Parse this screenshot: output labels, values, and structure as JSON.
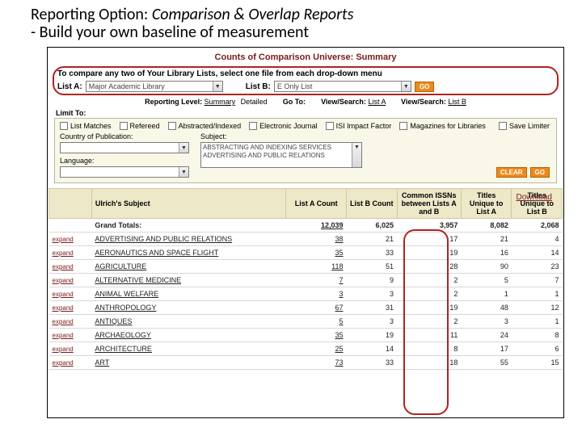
{
  "slide": {
    "title_prefix": "Reporting Option: ",
    "title_ital": "Comparison & Overlap Reports",
    "subtitle": " - Build your own baseline of measurement"
  },
  "report": {
    "title": "Counts of Comparison Universe: Summary",
    "compare_instruction": "To compare any two of Your Library Lists, select one file from each drop-down menu",
    "list_a_label": "List A:",
    "list_a_value": "Major Academic Library",
    "list_b_label": "List B:",
    "list_b_value": "E Only List",
    "go_label": "GO"
  },
  "reporting_line": {
    "level_label": "Reporting Level:",
    "level_summary": "Summary",
    "level_detailed": "Detailed",
    "goto_label": "Go To:",
    "view_search_a": "View/Search:",
    "list_a": "List A",
    "view_search_b": "View/Search:",
    "list_b": "List B"
  },
  "limit_label": "Limit To:",
  "filters": {
    "checks": {
      "list_matches": "List Matches",
      "refereed": "Refereed",
      "abstracted": "Abstracted/Indexed",
      "ejournal": "Electronic Journal",
      "isi_impact": "ISI Impact Factor",
      "magazines": "Magazines for Libraries"
    },
    "save_limiter": "Save Limiter",
    "country_label": "Country of Publication:",
    "language_label": "Language:",
    "subject_label": "Subject:",
    "subject_opts": [
      "ABSTRACTING AND INDEXING SERVICES",
      "ADVERTISING AND PUBLIC RELATIONS"
    ],
    "clear": "CLEAR",
    "go": "GO"
  },
  "download": "Download",
  "headers": {
    "subject": "Ulrich's Subject",
    "listA": "List A Count",
    "listB": "List B Count",
    "common": "Common ISSNs between Lists A and B",
    "uniqueA": "Titles Unique to List A",
    "uniqueB": "Titles Unique to List B"
  },
  "grand_label": "Grand Totals:",
  "grand": {
    "a": "12,039",
    "b": "6,025",
    "c": "3,957",
    "ua": "8,082",
    "ub": "2,068"
  },
  "expand": "expand",
  "rows": [
    {
      "s": "ADVERTISING AND PUBLIC RELATIONS",
      "a": "38",
      "b": "21",
      "c": "17",
      "ua": "21",
      "ub": "4"
    },
    {
      "s": "AERONAUTICS AND SPACE FLIGHT",
      "a": "35",
      "b": "33",
      "c": "19",
      "ua": "16",
      "ub": "14"
    },
    {
      "s": "AGRICULTURE",
      "a": "118",
      "b": "51",
      "c": "28",
      "ua": "90",
      "ub": "23"
    },
    {
      "s": "ALTERNATIVE MEDICINE",
      "a": "7",
      "b": "9",
      "c": "2",
      "ua": "5",
      "ub": "7"
    },
    {
      "s": "ANIMAL WELFARE",
      "a": "3",
      "b": "3",
      "c": "2",
      "ua": "1",
      "ub": "1"
    },
    {
      "s": "ANTHROPOLOGY",
      "a": "67",
      "b": "31",
      "c": "19",
      "ua": "48",
      "ub": "12"
    },
    {
      "s": "ANTIQUES",
      "a": "5",
      "b": "3",
      "c": "2",
      "ua": "3",
      "ub": "1"
    },
    {
      "s": "ARCHAEOLOGY",
      "a": "35",
      "b": "19",
      "c": "11",
      "ua": "24",
      "ub": "8"
    },
    {
      "s": "ARCHITECTURE",
      "a": "25",
      "b": "14",
      "c": "8",
      "ua": "17",
      "ub": "6"
    },
    {
      "s": "ART",
      "a": "73",
      "b": "33",
      "c": "18",
      "ua": "55",
      "ub": "15"
    }
  ]
}
